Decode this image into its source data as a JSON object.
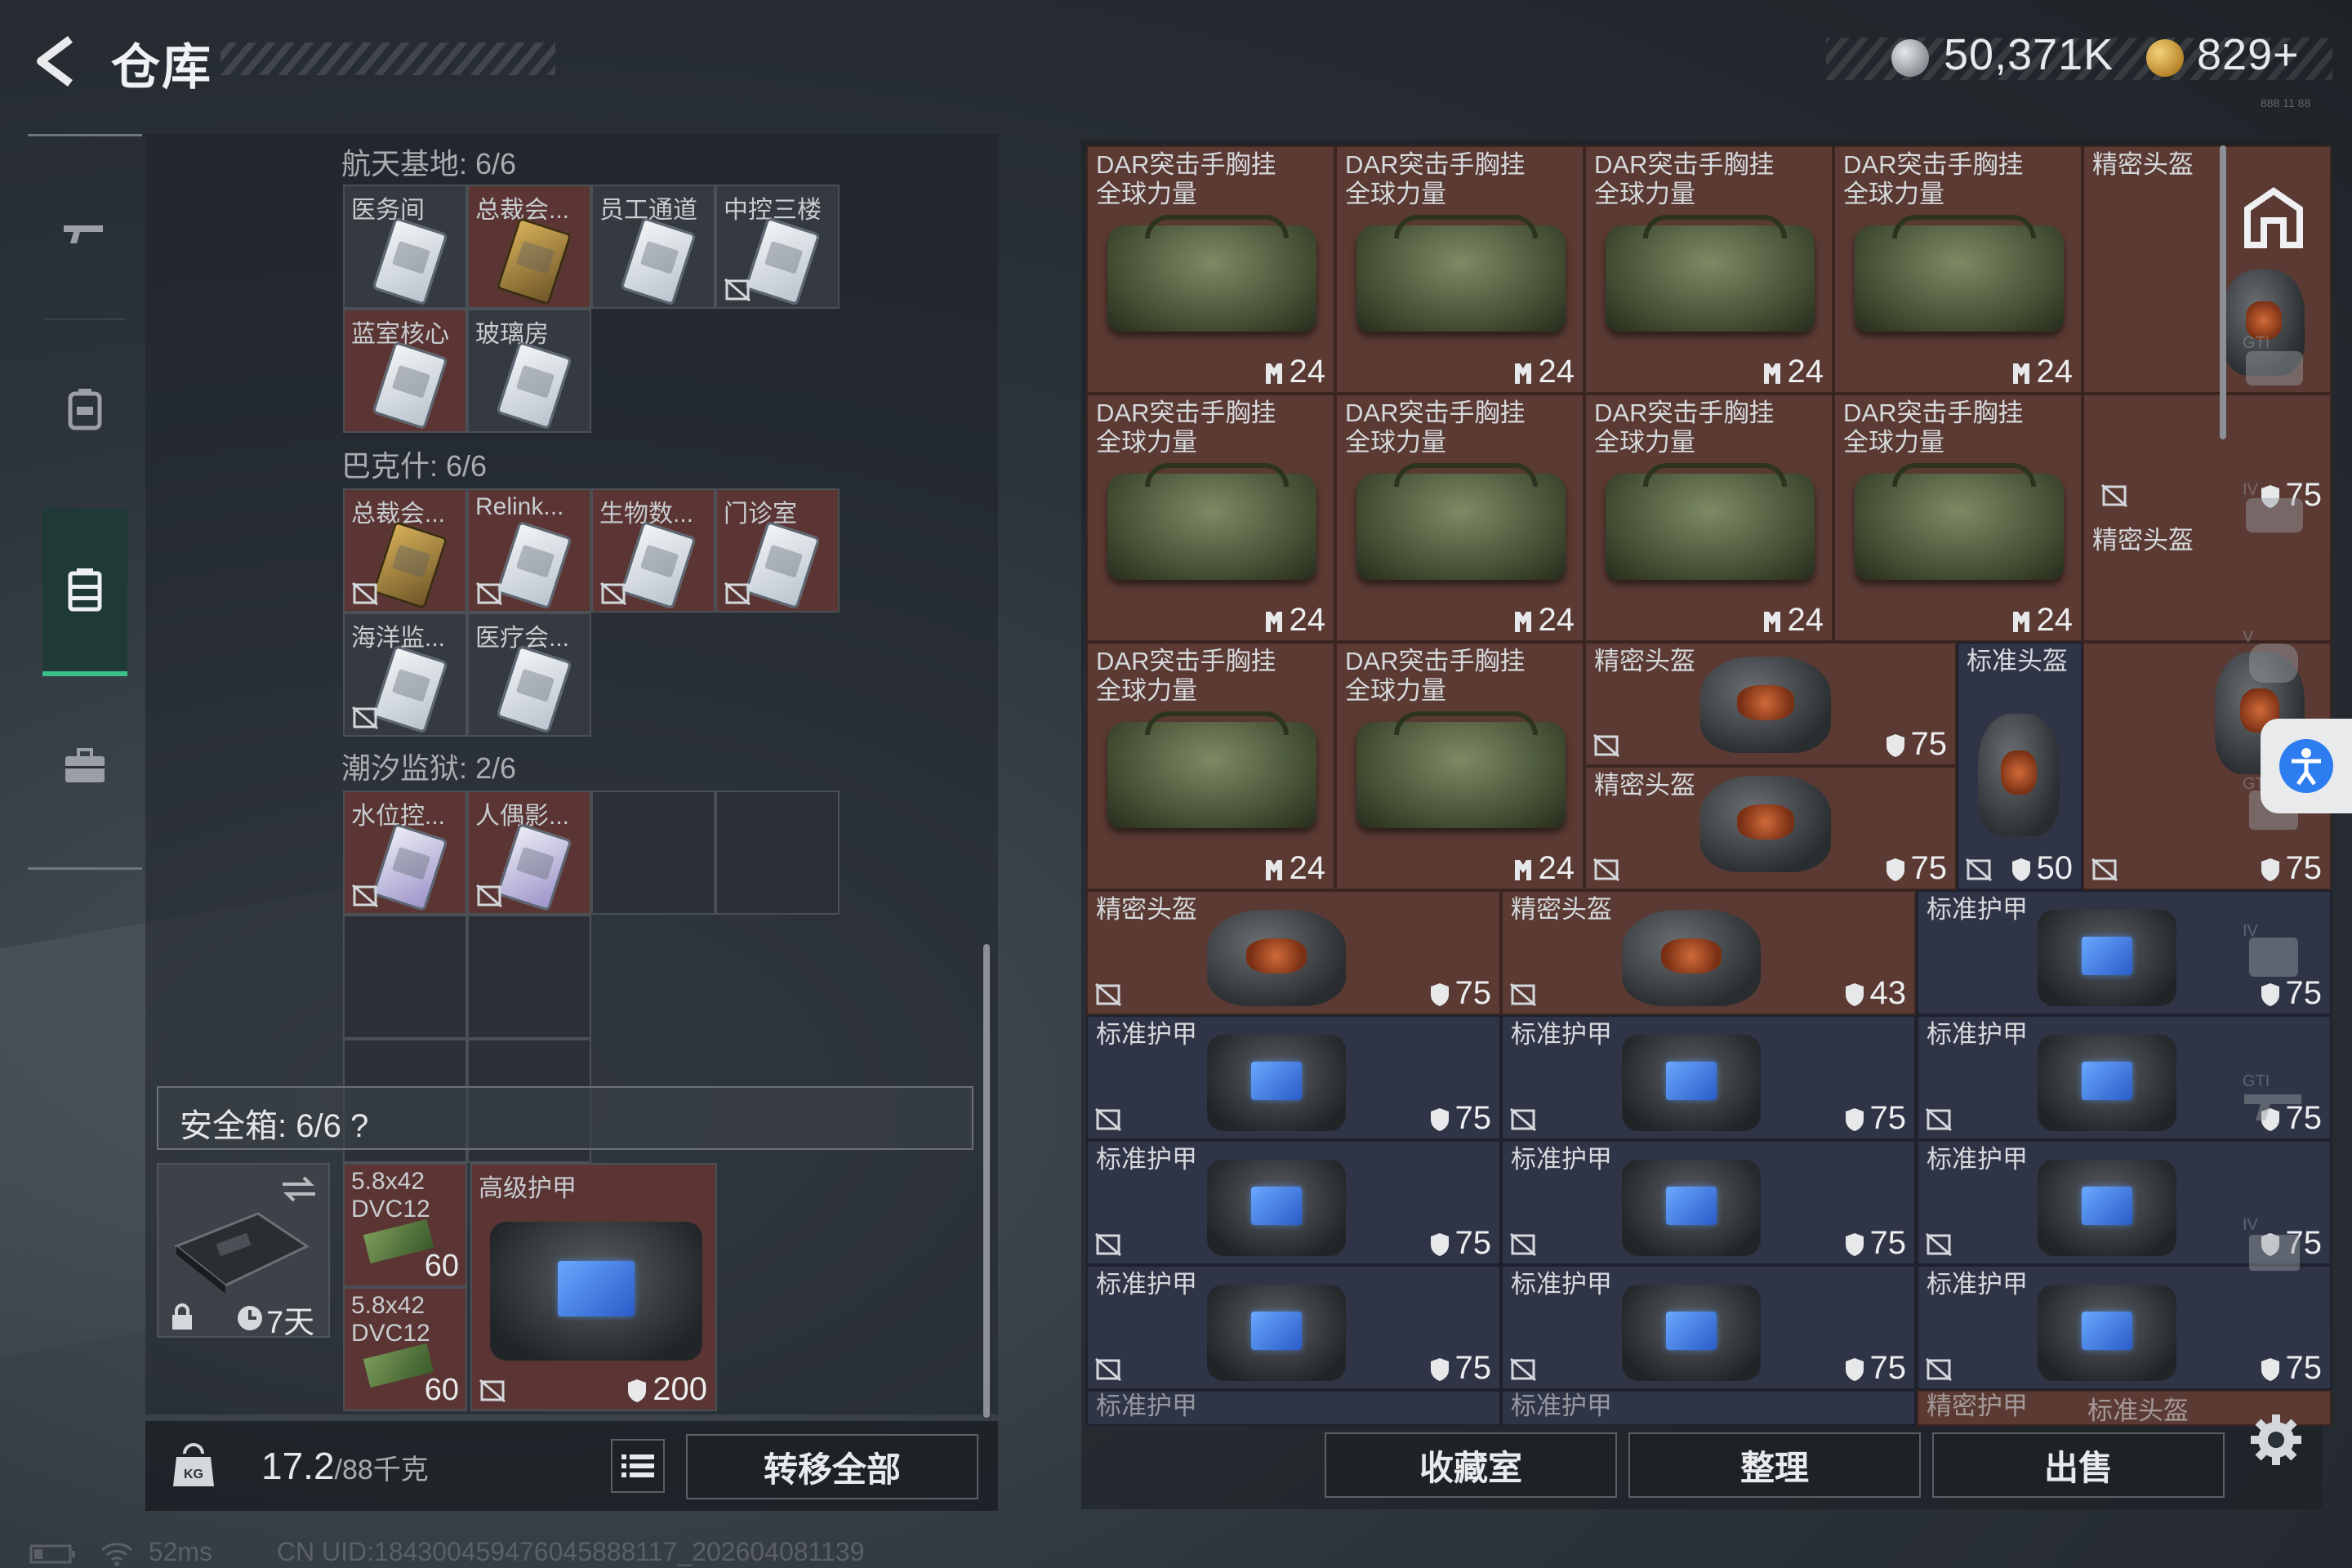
{
  "header": {
    "title": "仓库",
    "silver": "50,371K",
    "gold": "829+",
    "build_tag": "888 11 88"
  },
  "left_nav": {
    "items": [
      "weapon-icon",
      "backpack-icon",
      "container-icon",
      "briefcase-icon"
    ],
    "active_index": 2
  },
  "key_sections": [
    {
      "title": "航天基地: 6/6",
      "keys": [
        {
          "label": "医务间"
        },
        {
          "label": "总裁会..."
        },
        {
          "label": "员工通道"
        },
        {
          "label": "中控三楼"
        },
        {
          "label": "蓝室核心"
        },
        {
          "label": "玻璃房"
        }
      ]
    },
    {
      "title": "巴克什: 6/6",
      "keys": [
        {
          "label": "总裁会..."
        },
        {
          "label": "Relink..."
        },
        {
          "label": "生物数..."
        },
        {
          "label": "门诊室"
        },
        {
          "label": "海洋监..."
        },
        {
          "label": "医疗会..."
        }
      ]
    },
    {
      "title": "潮汐监狱: 2/6",
      "keys": [
        {
          "label": "水位控..."
        },
        {
          "label": "人偶影..."
        }
      ]
    }
  ],
  "safe": {
    "label": "安全箱:  6/6",
    "help": "?",
    "timer": "7天",
    "ammo": [
      {
        "label": "5.8x42\nDVC12",
        "count": "60"
      },
      {
        "label": "5.8x42\nDVC12",
        "count": "60"
      }
    ],
    "armor": {
      "label": "高级护甲",
      "durability": "200"
    }
  },
  "bottom_left": {
    "weight": "17.2",
    "weight_max": "/88千克",
    "transfer_all": "转移全部"
  },
  "grid": {
    "rig_label_1": "DAR突击手胸挂",
    "rig_label_2": "全球力量",
    "rig_count": "24",
    "helmet_precise": "精密头盔",
    "helmet_standard": "标准头盔",
    "armor_standard": "标准护甲",
    "armor_precise": "精密护甲",
    "values": {
      "v75": "75",
      "v50": "50",
      "v43": "43"
    }
  },
  "bottom_right": {
    "collection": "收藏室",
    "sort": "整理",
    "sell": "出售"
  },
  "status": {
    "ping": "52ms",
    "uid": "CN UID:184300459476045888117_202604081139"
  }
}
